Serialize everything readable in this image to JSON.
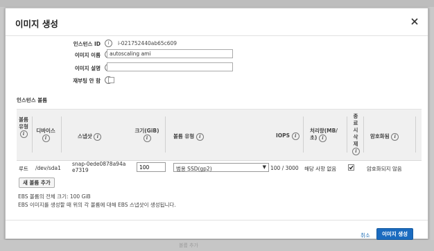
{
  "dialog": {
    "title": "이미지 생성"
  },
  "form": {
    "instance_id_label": "인스턴스 ID",
    "instance_id_value": "i-021752440ab65c609",
    "image_name_label": "이미지 이름",
    "image_name_value": "autoscaling ami",
    "image_desc_label": "이미지 설명",
    "image_desc_value": "",
    "no_reboot_label": "재부팅 안 함",
    "no_reboot_checked": false
  },
  "volumes": {
    "section_label": "인스턴스 볼륨",
    "headers": {
      "volume_type": "볼륨 유형",
      "device": "디바이스",
      "snapshot": "스냅샷",
      "size": "크기(GiB)",
      "volume_kind": "볼륨 유형",
      "iops": "IOPS",
      "throughput": "처리량(MB/초)",
      "delete_on_termination": "종료 시 삭제",
      "encrypted": "암호화됨"
    },
    "row": {
      "volume_type": "루트",
      "device": "/dev/sda1",
      "snapshot": "snap-0ede0878a94ae7319",
      "size": "100",
      "volume_kind": "범용 SSD(gp2)",
      "iops": "100 / 3000",
      "throughput": "해당 사항 없음",
      "delete_on_termination": true,
      "encrypted": "암호화되지 않음"
    },
    "add_button": "새 볼륨 추가"
  },
  "notes": {
    "total_size": "EBS 볼륨의 전체 크기: 100 GiB",
    "snapshot_note": "EBS 이미지를 생성할 때 위의 각 볼륨에 대해 EBS 스냅샷이 생성됩니다."
  },
  "footer": {
    "cancel": "취소",
    "create": "이미지 생성"
  },
  "background": {
    "text": "볼륨 추가"
  },
  "icons": {
    "info": "i"
  },
  "colors": {
    "primary": "#1b6bbf",
    "link": "#2673b8",
    "table_header_bg": "#f0f0f0"
  }
}
